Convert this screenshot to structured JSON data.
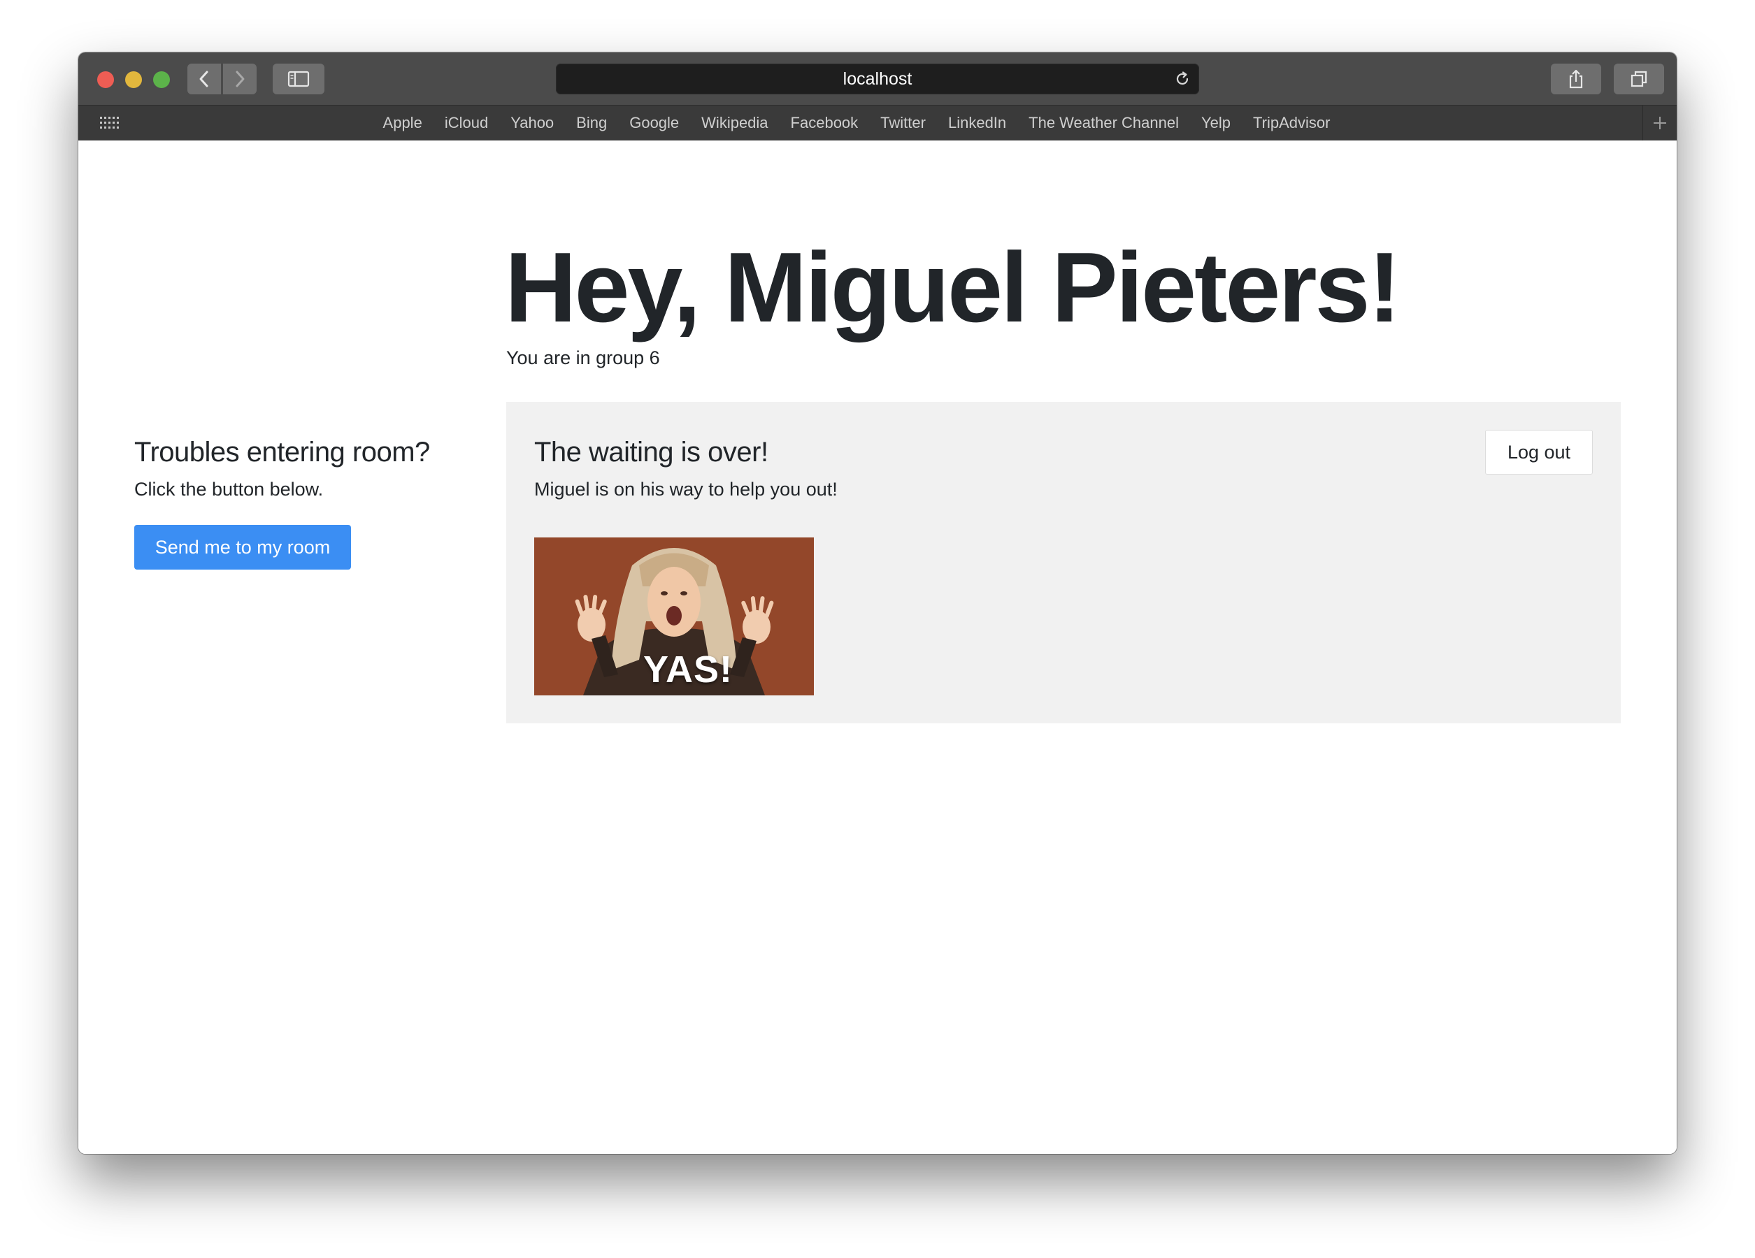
{
  "browser": {
    "url": "localhost",
    "favorites": [
      "Apple",
      "iCloud",
      "Yahoo",
      "Bing",
      "Google",
      "Wikipedia",
      "Facebook",
      "Twitter",
      "LinkedIn",
      "The Weather Channel",
      "Yelp",
      "TripAdvisor"
    ],
    "icons": {
      "back": "chevron-left-icon",
      "forward": "chevron-right-icon",
      "sidebar": "sidebar-icon",
      "reload": "reload-icon",
      "share": "share-icon",
      "tabs": "tabs-overview-icon",
      "favorites_grid": "grid-icon",
      "new_tab": "plus-icon"
    }
  },
  "page": {
    "greeting": "Hey, Miguel Pieters!",
    "group_text": "You are in group 6",
    "help": {
      "title": "Troubles entering room?",
      "description": "Click the button below.",
      "button_label": "Send me to my room"
    },
    "status": {
      "title": "The waiting is over!",
      "description": "Miguel is on his way to help you out!",
      "logout_label": "Log out",
      "gif_caption": "YAS!"
    }
  },
  "colors": {
    "primary_button": "#3b8ef3",
    "panel_background": "#f1f1f1",
    "text": "#212529",
    "toolbar": "#4b4b4b",
    "favorites_bar": "#3a3a3a"
  }
}
